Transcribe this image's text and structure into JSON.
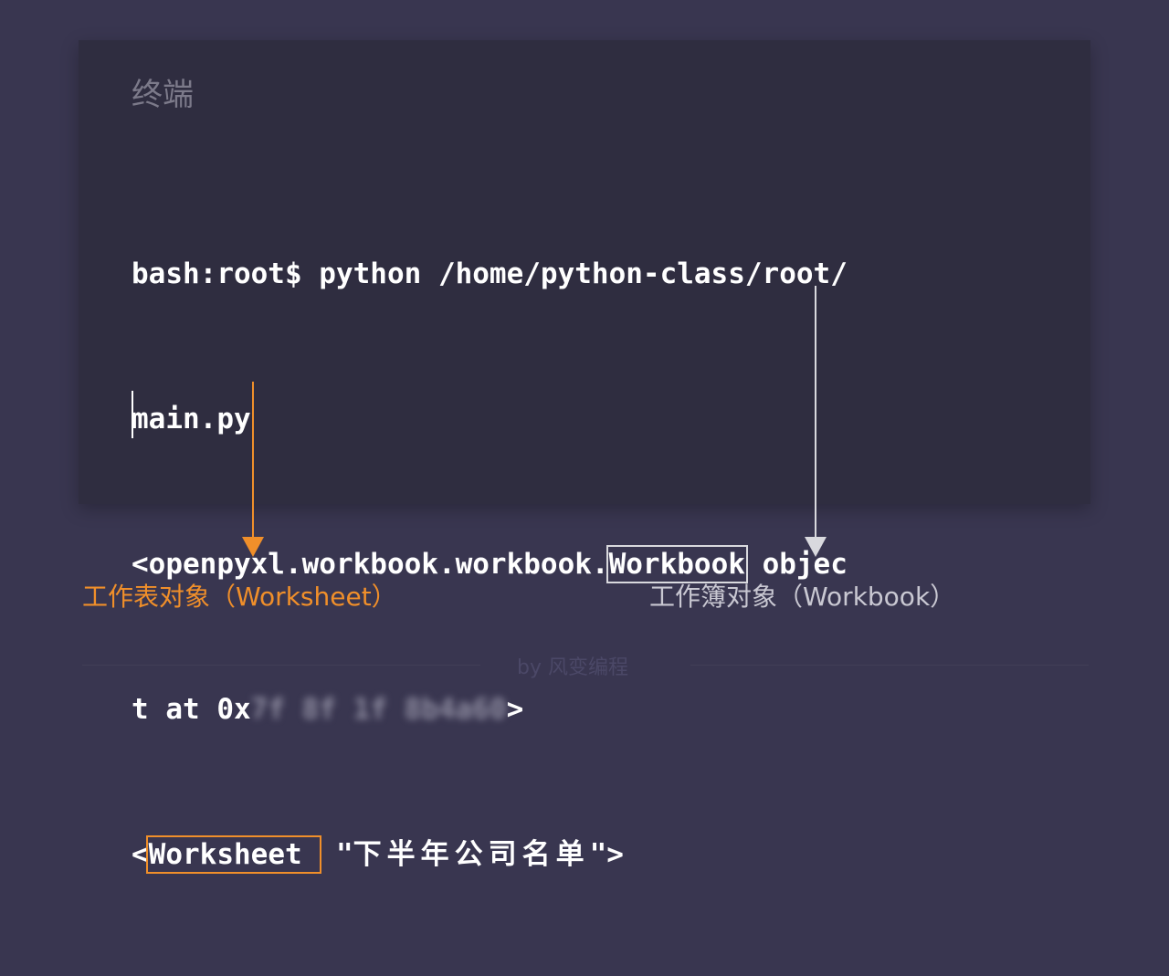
{
  "panel": {
    "title": "终端"
  },
  "terminal": {
    "line1": "bash:root$ python /home/python-class/root/",
    "line2": "main.py",
    "line3_prefix": "<openpyxl.workbook.workbook.",
    "line3_highlight": "Workbook",
    "line3_suffix": " objec",
    "line4_prefix": "t at 0x",
    "line4_blurred": "7f 8f 1f 8b4a60",
    "line4_suffix": ">",
    "line5_prefix": "<",
    "line5_highlight": "Worksheet ",
    "line5_suffix": " \"",
    "line5_sheet_name": "下半年公司名单",
    "line5_end": "\">"
  },
  "annotations": {
    "worksheet_label": "工作表对象（Worksheet）",
    "workbook_label": "工作簿对象（Workbook）"
  },
  "colors": {
    "background": "#393650",
    "panel": "#2f2d40",
    "worksheet_accent": "#f08f2a",
    "workbook_accent": "#d9d9de"
  },
  "footer": {
    "text": "by 风变编程"
  }
}
